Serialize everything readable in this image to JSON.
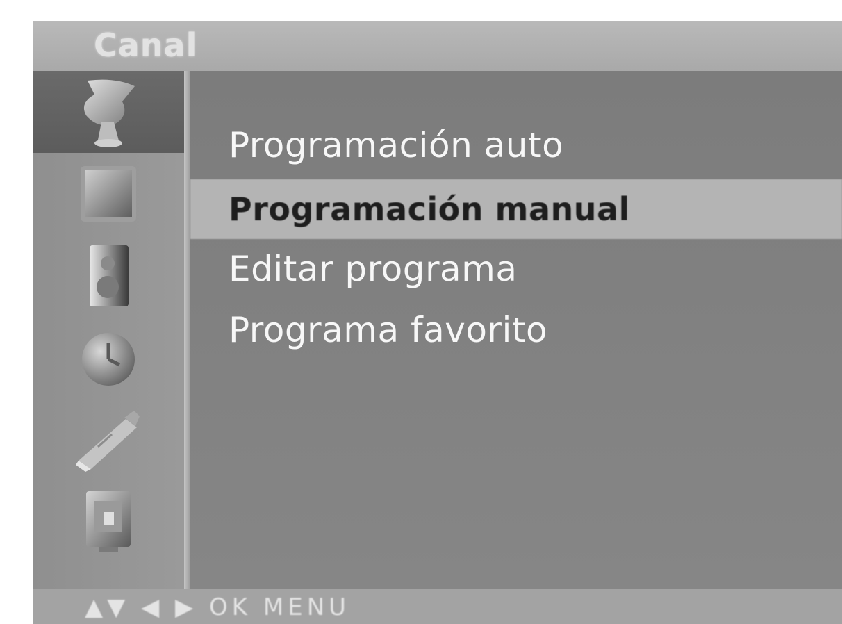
{
  "menu": {
    "title": "Canal",
    "icons": [
      "satellite-dish-icon",
      "picture-icon",
      "speaker-icon",
      "clock-icon",
      "settings-icon",
      "input-icon"
    ],
    "active_icon": "satellite-dish-icon",
    "items": [
      {
        "label": "Programación auto"
      },
      {
        "label": "Programación manual"
      },
      {
        "label": "Editar programa"
      },
      {
        "label": "Programa favorito"
      }
    ],
    "selected_item": "Programación manual",
    "footer_hint": "▲▼ ◀ ▶ OK MENU"
  },
  "colors": {
    "background": "#8a8a8a",
    "highlight": "#b4b4b4",
    "active_icon_bg": "#5c5c5c"
  }
}
